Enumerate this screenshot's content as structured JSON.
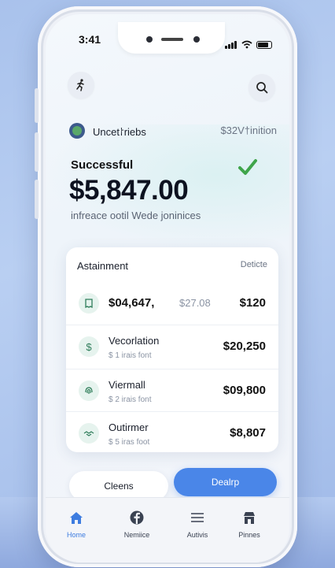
{
  "status_bar": {
    "time": "3:41"
  },
  "account": {
    "name": "Uncet⸷riebs",
    "right_text": "$32V†inition"
  },
  "payment": {
    "status": "Successful",
    "amount": "$5,847.00",
    "subtitle": "infreace ootil Wede joninices"
  },
  "transactions": {
    "title": "Astainment",
    "right_label": "Deticte",
    "items": [
      {
        "name": "$04,647,",
        "extra": "$27.08",
        "sub": "",
        "amount": "$120",
        "icon": "receipt-icon"
      },
      {
        "name": "Vecorlation",
        "extra": "",
        "sub": "$ 1 irais font",
        "amount": "$20,250",
        "icon": "dollar-icon"
      },
      {
        "name": "Viermall",
        "extra": "",
        "sub": "$ 2 irais font",
        "amount": "$09,800",
        "icon": "fingerprint-icon"
      },
      {
        "name": "Outirmer",
        "extra": "",
        "sub": "$ 5 iras foot",
        "amount": "$8,807",
        "icon": "handshake-icon"
      }
    ]
  },
  "buttons": {
    "secondary": "Cleens",
    "primary": "Dealrp"
  },
  "tabs": [
    {
      "label": "Home",
      "icon": "home-icon",
      "active": true
    },
    {
      "label": "Nemiice",
      "icon": "facebook-icon",
      "active": false
    },
    {
      "label": "Autivis",
      "icon": "list-icon",
      "active": false
    },
    {
      "label": "Pinnes",
      "icon": "shop-icon",
      "active": false
    }
  ],
  "colors": {
    "accent": "#4a86e8",
    "success": "#3fa54a",
    "background": "#eef1f7"
  }
}
